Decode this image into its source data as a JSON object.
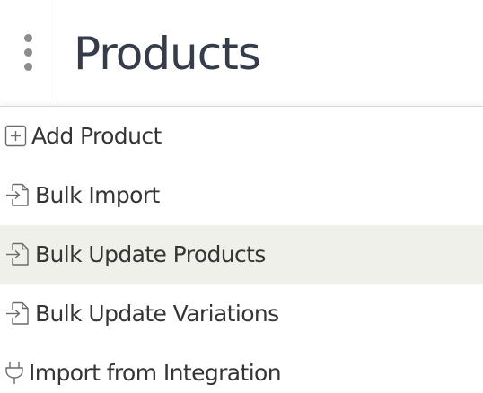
{
  "header": {
    "title": "Products",
    "menu_button_icon": "kebab-vertical-icon"
  },
  "menu": {
    "items": [
      {
        "label": "Add Product",
        "icon": "plus-square-icon"
      },
      {
        "label": "Bulk Import",
        "icon": "file-import-icon"
      },
      {
        "label": "Bulk Update Products",
        "icon": "file-import-icon",
        "highlighted": true
      },
      {
        "label": "Bulk Update Variations",
        "icon": "file-import-icon"
      },
      {
        "label": "Import from Integration",
        "icon": "plug-icon"
      }
    ]
  },
  "colors": {
    "title": "#353d4a",
    "label": "#353535",
    "icon": "#6a6a6a",
    "highlight": "#f0f0ea",
    "kebab_dots": "#8c8c8c"
  }
}
